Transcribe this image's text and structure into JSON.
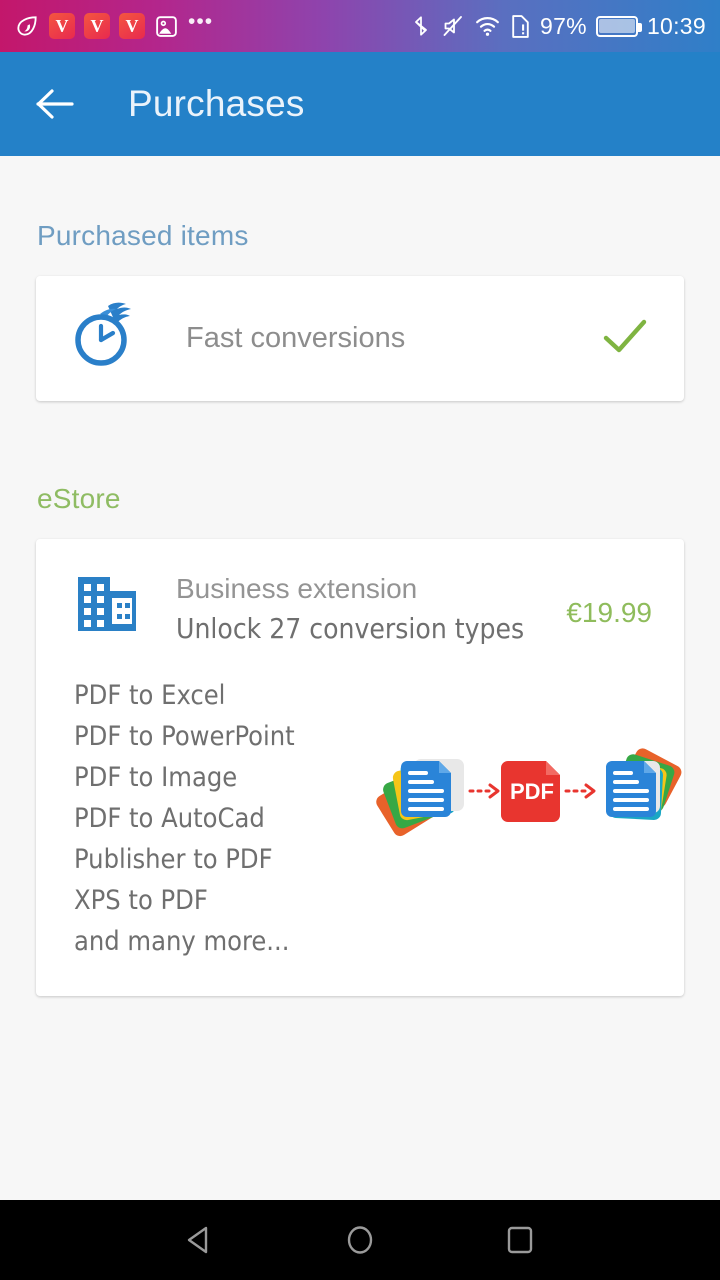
{
  "status_bar": {
    "left_icons": [
      {
        "name": "leaf-eye-icon",
        "label": ""
      },
      {
        "name": "app-badge-v-1",
        "label": "V"
      },
      {
        "name": "app-badge-v-2",
        "label": "V"
      },
      {
        "name": "app-badge-v-3",
        "label": "V"
      },
      {
        "name": "photo-icon",
        "label": ""
      },
      {
        "name": "more-notifications-icon",
        "label": "•••"
      }
    ],
    "bluetooth_icon": "bluetooth-icon",
    "mute_icon": "volume-mute-icon",
    "wifi_icon": "wifi-icon",
    "sim_icon": "sim-card-alert-icon",
    "battery_percent": "97%",
    "battery_icon": "battery-full-icon",
    "time": "10:39"
  },
  "app_bar": {
    "back_icon": "back-arrow-icon",
    "title": "Purchases",
    "background_color": "#2481c8"
  },
  "purchased": {
    "header": "Purchased items",
    "header_color": "#6f9dc2",
    "items": [
      {
        "icon": "fast-clock-icon",
        "label": "Fast conversions",
        "status_icon": "check-icon",
        "status_color": "#7fb441"
      }
    ]
  },
  "estore": {
    "header": "eStore",
    "header_color": "#8fbc63",
    "product": {
      "icon": "office-building-icon",
      "title": "Business extension",
      "subtitle": "Unlock 27 conversion types",
      "price": "€19.99",
      "price_color": "#8fbc5c",
      "features": [
        "PDF to Excel",
        "PDF to PowerPoint",
        "PDF to Image",
        "PDF to AutoCad",
        "Publisher to PDF",
        "XPS to PDF",
        "and many more..."
      ],
      "illustration": {
        "left_icon": "documents-stack-icon",
        "arrow_1": "dashed-arrow-right-icon",
        "center_icon": "pdf-file-icon",
        "center_label": "PDF",
        "arrow_2": "dashed-arrow-right-icon",
        "right_icon": "documents-stack-icon"
      }
    }
  },
  "nav_bar": {
    "back": "nav-back-icon",
    "home": "nav-home-icon",
    "recents": "nav-recents-icon"
  }
}
